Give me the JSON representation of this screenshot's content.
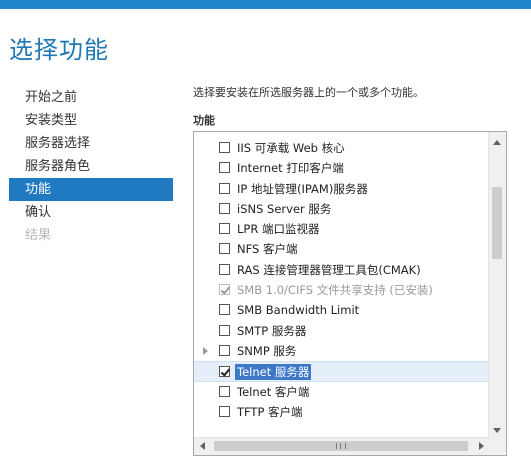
{
  "title": "选择功能",
  "nav": {
    "items": [
      {
        "label": "开始之前",
        "state": "normal"
      },
      {
        "label": "安装类型",
        "state": "normal"
      },
      {
        "label": "服务器选择",
        "state": "normal"
      },
      {
        "label": "服务器角色",
        "state": "normal"
      },
      {
        "label": "功能",
        "state": "active"
      },
      {
        "label": "确认",
        "state": "normal"
      },
      {
        "label": "结果",
        "state": "disabled"
      }
    ]
  },
  "main": {
    "description": "选择要安装在所选服务器上的一个或多个功能。",
    "section_label": "功能",
    "features": [
      {
        "label": "IIS 可承载 Web 核心",
        "checked": false
      },
      {
        "label": "Internet 打印客户端",
        "checked": false
      },
      {
        "label": "IP 地址管理(IPAM)服务器",
        "checked": false
      },
      {
        "label": "iSNS Server 服务",
        "checked": false
      },
      {
        "label": "LPR 端口监视器",
        "checked": false
      },
      {
        "label": "NFS 客户端",
        "checked": false
      },
      {
        "label": "RAS 连接管理器管理工具包(CMAK)",
        "checked": false
      },
      {
        "label": "SMB 1.0/CIFS 文件共享支持 (已安装)",
        "checked": true,
        "disabled": true
      },
      {
        "label": "SMB Bandwidth Limit",
        "checked": false
      },
      {
        "label": "SMTP 服务器",
        "checked": false
      },
      {
        "label": "SNMP 服务",
        "checked": false,
        "expandable": true
      },
      {
        "label": "Telnet 服务器",
        "checked": true,
        "selected": true
      },
      {
        "label": "Telnet 客户端",
        "checked": false
      },
      {
        "label": "TFTP 客户端",
        "checked": false
      }
    ]
  },
  "colors": {
    "accent": "#1f7ac2",
    "title": "#1f77b4",
    "top_bar": "#1f87c9",
    "selection_highlight": "#3c78c8"
  },
  "icons": {
    "expander": "triangle-right",
    "scroll_up": "triangle-up",
    "scroll_down": "triangle-down",
    "scroll_left": "triangle-left",
    "scroll_right": "triangle-right"
  }
}
